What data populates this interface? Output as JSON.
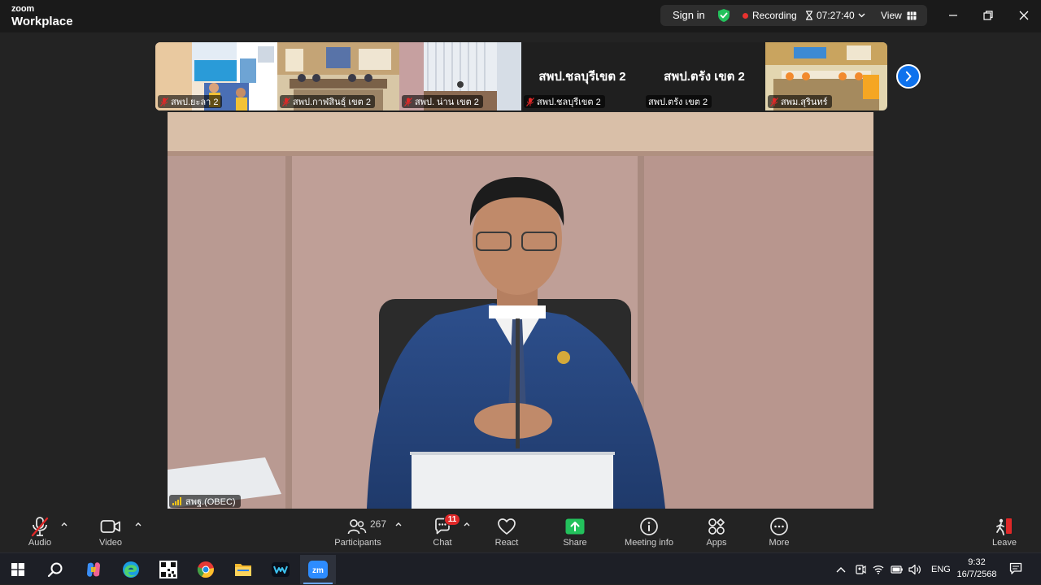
{
  "app": {
    "brand_small": "zoom",
    "brand_name": "Workplace",
    "sign_in": "Sign in",
    "recording": "Recording",
    "elapsed": "07:27:40",
    "view": "View"
  },
  "gallery": {
    "tiles": [
      {
        "label": "สพป.ยะลา 2",
        "muted": true,
        "big_text": ""
      },
      {
        "label": "สพป.กาฬสินธุ์ เขต 2",
        "muted": true,
        "big_text": ""
      },
      {
        "label": "สพป. น่าน เขต 2",
        "muted": true,
        "big_text": ""
      },
      {
        "label": "สพป.ชลบุรีเขต 2",
        "muted": true,
        "big_text": "สพป.ชลบุรีเขต 2"
      },
      {
        "label": "สพป.ตรัง เขต 2",
        "muted": false,
        "big_text": "สพป.ตรัง เขต 2"
      },
      {
        "label": "สพม.สุรินทร์",
        "muted": true,
        "big_text": ""
      }
    ]
  },
  "speaker": {
    "name": "สพฐ.(OBEC)"
  },
  "toolbar": {
    "audio": "Audio",
    "video": "Video",
    "participants": "Participants",
    "participants_count": "267",
    "chat": "Chat",
    "chat_badge": "11",
    "react": "React",
    "share": "Share",
    "meeting_info": "Meeting info",
    "apps": "Apps",
    "more": "More",
    "leave": "Leave"
  },
  "taskbar": {
    "lang": "ENG",
    "time": "9:32",
    "date": "16/7/2568"
  },
  "colors": {
    "accent_blue": "#0e72ed",
    "share_green": "#23c15c",
    "recording_red": "#e8322f",
    "badge_red": "#e02828",
    "leave_red": "#e02828"
  }
}
